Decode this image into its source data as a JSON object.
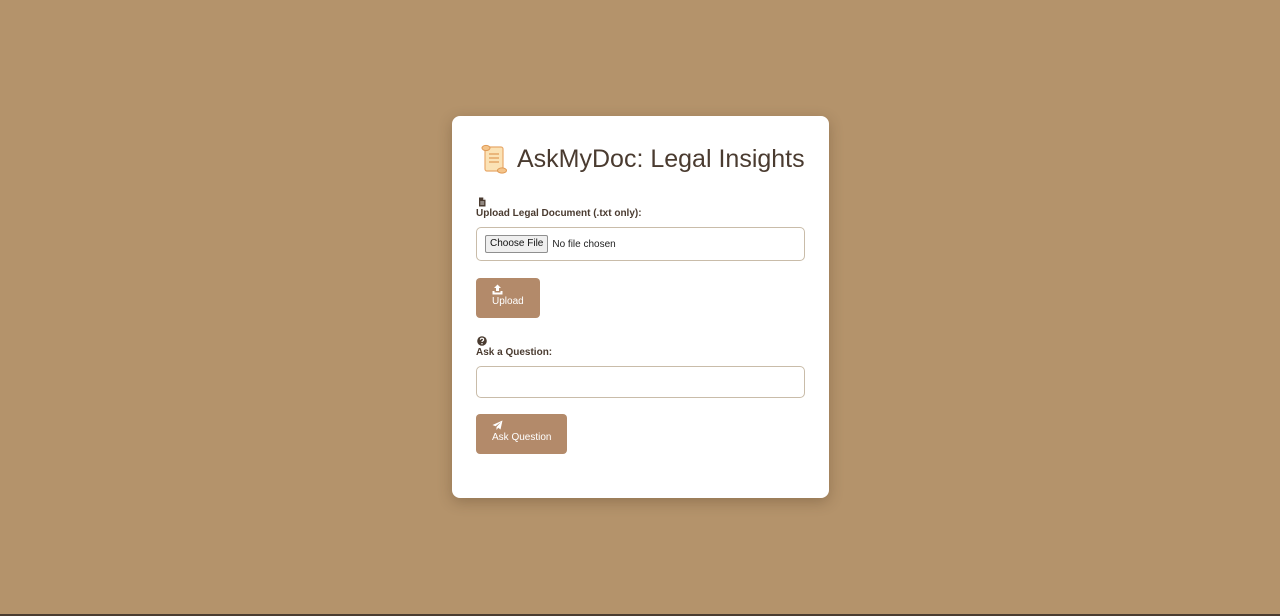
{
  "app": {
    "title": "AskMyDoc: Legal Insights",
    "title_icon": "scroll-icon"
  },
  "upload": {
    "icon": "file-icon",
    "label": "Upload Legal Document (.txt only):",
    "choose_button": "Choose File",
    "file_status": "No file chosen",
    "button_icon": "upload-icon",
    "button_label": "Upload"
  },
  "question": {
    "icon": "question-circle-icon",
    "label": "Ask a Question:",
    "value": "",
    "button_icon": "paper-plane-icon",
    "button_label": "Ask Question"
  },
  "colors": {
    "background": "#b4936b",
    "card": "#ffffff",
    "button": "#b38a6a",
    "text": "#4a3b30"
  }
}
